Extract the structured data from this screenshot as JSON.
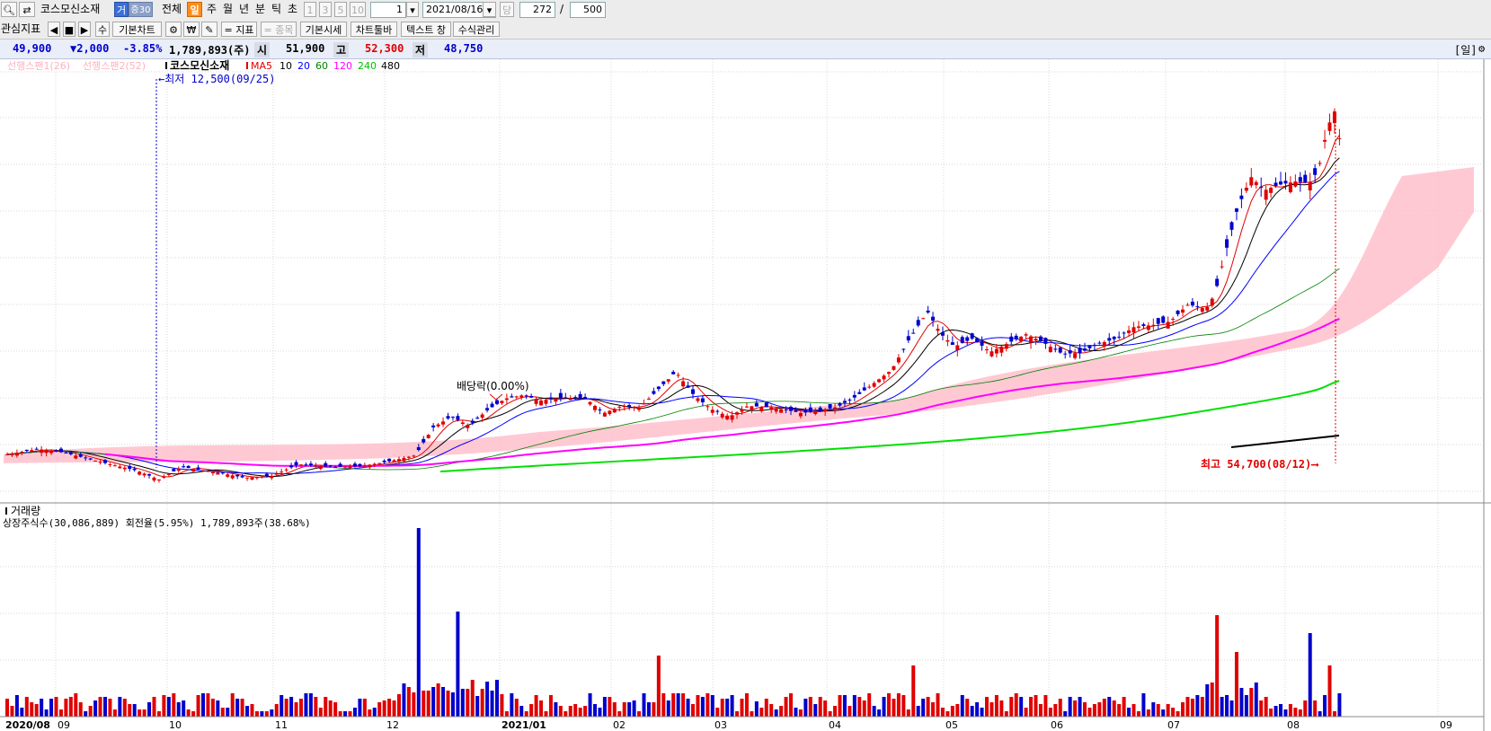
{
  "toolbar1": {
    "search_icon": "magnifier-icon",
    "refresh_icon": "swap-icon",
    "stock_name": "코스모신소재",
    "badge_a": "거",
    "badge_b": "증30",
    "all": "전체",
    "periods": [
      "일",
      "주",
      "월",
      "년",
      "분",
      "틱",
      "초"
    ],
    "selected_period": "일",
    "intervals": [
      "1",
      "3",
      "5",
      "10"
    ],
    "interval_value": "1",
    "date": "2021/08/16",
    "dang": "당",
    "count": "272",
    "slash": "/",
    "total": "500"
  },
  "toolbar2": {
    "indicator": "관심지표",
    "prev": "◀",
    "mid": "■",
    "next": "▶",
    "su": "수",
    "basic_chart": "기본차트",
    "won": "₩",
    "index": "= 지표",
    "item": "= 종목",
    "basic_quote": "기본시세",
    "chart_toolbar": "차트툴바",
    "text_window": "텍스트 창",
    "formula": "수식관리"
  },
  "info": {
    "price": "49,900",
    "change": "▼2,000",
    "rate": "-3.85%",
    "volume": "1,789,893(주)",
    "open_label": "시",
    "open": "51,900",
    "high_label": "고",
    "high": "52,300",
    "low_label": "저",
    "low": "48,750",
    "period": "[일]"
  },
  "legend": {
    "span1": "선행스팬1(26)",
    "span2": "선행스팬2(52)",
    "name": "코스모신소재",
    "ma": "MA",
    "ma_periods": [
      "5",
      "10",
      "20",
      "60",
      "120",
      "240",
      "480"
    ],
    "ma_colors": [
      "#e00000",
      "#000000",
      "#0000ff",
      "#008000",
      "#ff00ff",
      "#00c000",
      "#000000"
    ]
  },
  "annotations": {
    "low": "←최저 12,500(09/25)",
    "high": "최고 54,700(08/12)⟶",
    "dividend": "배당락(0.00%)"
  },
  "volume_panel": {
    "title": "거래량",
    "subtitle": "상장주식수(30,086,889) 회전율(5.95%) 1,789,893주(38.68%)"
  },
  "x_axis": [
    "2020/08",
    "09",
    "10",
    "11",
    "12",
    "2021/01",
    "02",
    "03",
    "04",
    "05",
    "06",
    "07",
    "08",
    "09"
  ],
  "colors": {
    "up": "#e00000",
    "down": "#0000cc",
    "cloud": "#ffc0cb"
  }
}
